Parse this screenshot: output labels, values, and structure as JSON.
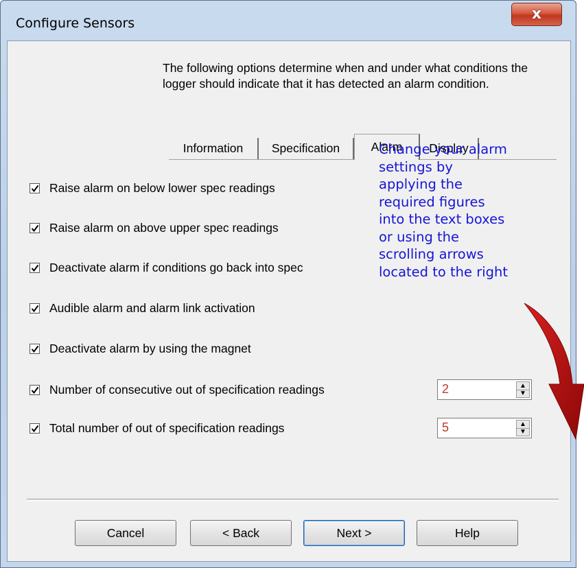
{
  "window": {
    "title": "Configure Sensors",
    "close_label": "x"
  },
  "intro": "The following options determine when and under what conditions the logger should indicate that it has detected an alarm condition.",
  "tabs": [
    {
      "label": "Information",
      "active": false
    },
    {
      "label": "Specification",
      "active": false
    },
    {
      "label": "Alarm",
      "active": true
    },
    {
      "label": "Display",
      "active": false
    }
  ],
  "options": [
    {
      "label": "Raise alarm on below lower spec readings",
      "checked": true
    },
    {
      "label": "Raise alarm on above upper spec readings",
      "checked": true
    },
    {
      "label": "Deactivate alarm if conditions go back into spec",
      "checked": true
    },
    {
      "label": "Audible alarm and alarm link activation",
      "checked": true
    },
    {
      "label": "Deactivate alarm by using the magnet",
      "checked": true
    },
    {
      "label": "Number of consecutive out of specification readings",
      "checked": true
    },
    {
      "label": "Total number of out of specification readings",
      "checked": true
    }
  ],
  "spinners": {
    "consecutive": "2",
    "total": "5"
  },
  "annotation": {
    "lines": [
      "Change your alarm",
      "settings by",
      "applying the",
      "required figures",
      "into the text boxes",
      "or using the",
      "scrolling arrows",
      "located to the right"
    ],
    "color": "#1515d6",
    "arrow_color": "#b50d0d"
  },
  "buttons": {
    "cancel": "Cancel",
    "back": "< Back",
    "next": "Next >",
    "help": "Help"
  }
}
